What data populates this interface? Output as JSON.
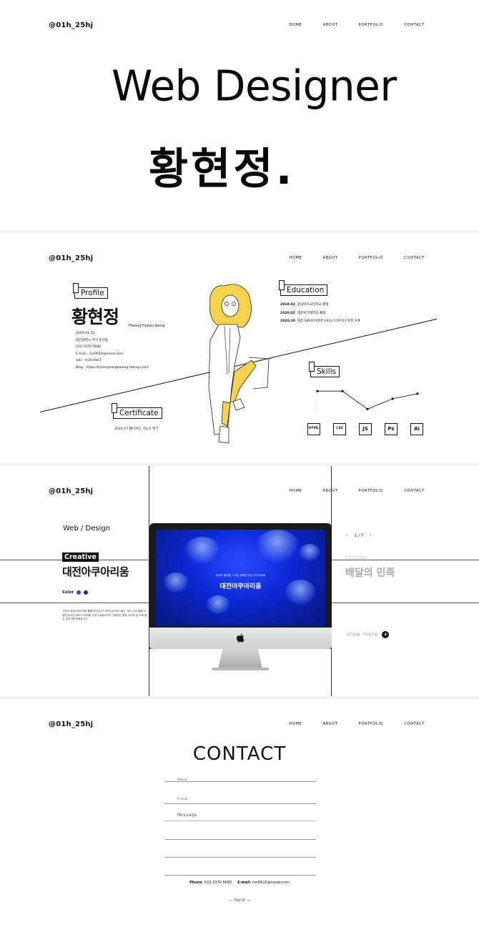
{
  "nav": {
    "logo": "@01h_25hj",
    "items": [
      "HOME",
      "ABOUT",
      "PORTFOLIO",
      "CONTACT"
    ]
  },
  "hero": {
    "line1": "Web Designer",
    "line2": "황현정."
  },
  "profile": {
    "tag_profile": "Profile",
    "tag_education": "Education",
    "tag_skills": "Skills",
    "tag_certificate": "Certificate",
    "name": "황현정",
    "name_en": "Hwang Hyeon jeong",
    "info": [
      "2000.01.25",
      "대전광역시 서구 둔산동",
      "010 3370 5680",
      "E-mail : mn0610@naver.com",
      "wiki : tr2kr/lkk5",
      "Blog : https://hyeonjeonghwang.tistory.com/"
    ],
    "education": [
      {
        "date": "2018.02",
        "text": "충남미사고등학교 졸업"
      },
      {
        "date": "2020.02",
        "text": "대전보건대학교 졸업"
      },
      {
        "date": "2020.10",
        "text": "대전 SBS아카데미 UX/UI 디자이너 과정 수료"
      }
    ],
    "certificate": "2020.07 웹디자인 기능사 필기",
    "skills": [
      "HTML",
      "CSS",
      "JS",
      "Ps",
      "Ai"
    ],
    "skill_levels": [
      0.8,
      0.8,
      0.1,
      0.5,
      0.7
    ]
  },
  "portfolio": {
    "category": "Web / Design",
    "badge": "Creative",
    "title": "대전아쿠아리움",
    "color_label": "Color",
    "colors": [
      "#2b4ae6",
      "#3a1f86"
    ],
    "description": "기업의 대전아쿠아리움 홈페이지입니다 대전으로 떠나 돌고, 바다 사유 물을 다양한 동식은 바다가 부터를 구성고 홈페이지가 기동에는 중층 나아와 존 도에 볼 수 있게 제작하였습니다",
    "screen_heading": "대전아쿠아리움",
    "screen_sub": "한국의 블루를, 느끼는 평화한 대전 아쿠아리움",
    "pager": "1 / 7",
    "next_tag": "Imitation",
    "next_title": "배달의 민족",
    "view_more": "view more"
  },
  "contact": {
    "title": "CONTACT",
    "name_label": "Name",
    "email_label": "E-mail",
    "message_label": "Message",
    "phone_label": "Phone",
    "phone": "010 3370 5680",
    "email_label2": "E-mail",
    "email": "mn0610@naver.com",
    "send": "Send"
  }
}
